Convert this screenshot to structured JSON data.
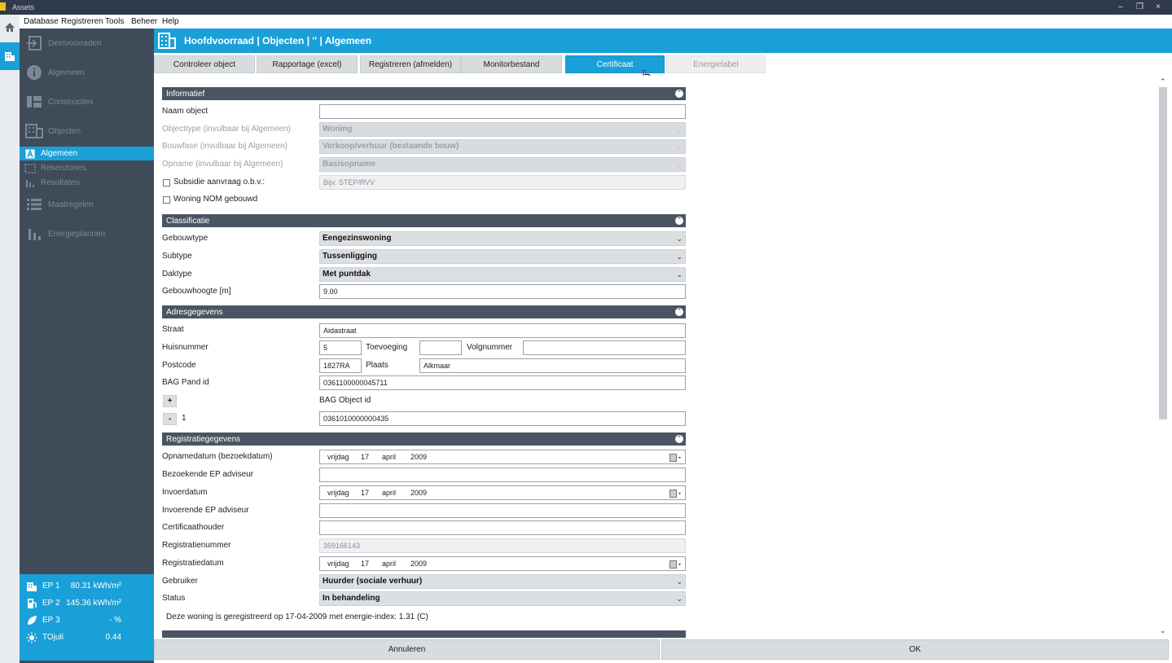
{
  "titlebar": {
    "title": "Assets",
    "minimize": "–",
    "restore": "❐",
    "close": "×"
  },
  "menu": [
    "Database",
    "Registreren",
    "Tools",
    "Beheer",
    "Help"
  ],
  "sidebar": {
    "items": [
      "Deelvoorraden",
      "Algemeen",
      "Constructies",
      "Objecten"
    ],
    "subitems": [
      "Algemeen",
      "Rekenzones",
      "Resultaten"
    ],
    "items2": [
      "Maatregelen",
      "Energieplannen"
    ]
  },
  "ep": [
    {
      "key": "EP 1",
      "value": "80.31 kWh/m²"
    },
    {
      "key": "EP 2",
      "value": "145.36 kWh/m²"
    },
    {
      "key": "EP 3",
      "value": "- %"
    },
    {
      "key": "TOjuli",
      "value": "0.44"
    }
  ],
  "header": {
    "title": "Hoofdvoorraad | Objecten | '' | Algemeen"
  },
  "tabs": [
    "Controleer object",
    "Rapportage (excel)",
    "Registreren (afmelden)",
    "Monitorbestand",
    "Certificaat",
    "Energielabel"
  ],
  "sections": {
    "informatief": "Informatief",
    "classificatie": "Classificatie",
    "adres": "Adresgegevens",
    "registratie": "Registratiegegevens"
  },
  "informatief": {
    "naam_label": "Naam object",
    "naam_value": "",
    "objecttype_label": "Objecttype (invulbaar bij Algemeen)",
    "objecttype_value": "Woning",
    "bouwfase_label": "Bouwfase (invulbaar bij Algemeen)",
    "bouwfase_value": "Verkoop/verhuur (bestaande bouw)",
    "opname_label": "Opname (invulbaar bij Algemeen)",
    "opname_value": "Basisopname",
    "subsidie_label": "Subsidie aanvraag o.b.v.:",
    "subsidie_placeholder": "Bijv. STEP/RVV",
    "nom_label": "Woning NOM gebouwd"
  },
  "classificatie": {
    "gebouwtype_label": "Gebouwtype",
    "gebouwtype_value": "Eengezinswoning",
    "subtype_label": "Subtype",
    "subtype_value": "Tussenligging",
    "daktype_label": "Daktype",
    "daktype_value": "Met puntdak",
    "hoogte_label": "Gebouwhoogte [m]",
    "hoogte_value": "9.00"
  },
  "adres": {
    "straat_label": "Straat",
    "straat_value": "Aidastraat",
    "huisnummer_label": "Huisnummer",
    "huisnummer_value": "5",
    "toevoeging_label": "Toevoeging",
    "toevoeging_value": "",
    "volgnummer_label": "Volgnummer",
    "volgnummer_value": "",
    "postcode_label": "Postcode",
    "postcode_value": "1827RA",
    "plaats_label": "Plaats",
    "plaats_value": "Alkmaar",
    "bagpand_label": "BAG Pand id",
    "bagpand_value": "0361100000045711",
    "plus": "+",
    "minus": "-",
    "bagobject_label": "BAG Object id",
    "bagobject_index": "1",
    "bagobject_value": "0361010000000435"
  },
  "registratie": {
    "opnamedatum_label": "Opnamedatum (bezoekdatum)",
    "opnamedatum": {
      "day": "vrijdag",
      "d": "17",
      "m": "april",
      "y": "2009"
    },
    "bezoekende_label": "Bezoekende EP adviseur",
    "bezoekende_value": "",
    "invoerdatum_label": "Invoerdatum",
    "invoerdatum": {
      "day": "vrijdag",
      "d": "17",
      "m": "april",
      "y": "2009"
    },
    "invoerende_label": "Invoerende  EP adviseur",
    "invoerende_value": "",
    "certhouder_label": "Certificaathouder",
    "certhouder_value": "",
    "regnummer_label": "Registratienummer",
    "regnummer_value": "359166143",
    "regdatum_label": "Registratiedatum",
    "regdatum": {
      "day": "vrijdag",
      "d": "17",
      "m": "april",
      "y": "2009"
    },
    "gebruiker_label": "Gebruiker",
    "gebruiker_value": "Huurder (sociale verhuur)",
    "status_label": "Status",
    "status_value": "In behandeling",
    "note": "Deze woning is geregistreerd op 17-04-2009 met energie-index: 1.31 (C)"
  },
  "footer": {
    "cancel": "Annuleren",
    "ok": "OK"
  },
  "colors": {
    "accent": "#1aa0d8",
    "sidebar": "#404b5a",
    "section": "#4a5563"
  }
}
